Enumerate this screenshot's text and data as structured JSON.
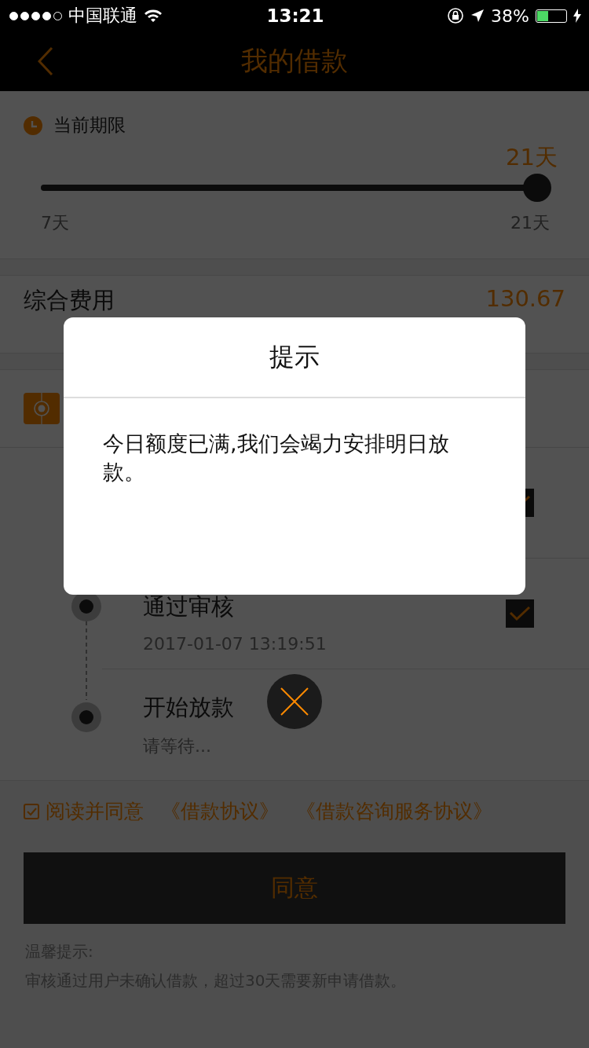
{
  "status_bar": {
    "signal_dots": [
      {
        "on": true
      },
      {
        "on": true
      },
      {
        "on": true
      },
      {
        "on": true
      },
      {
        "on": false
      }
    ],
    "carrier": "中国联通",
    "time": "13:21",
    "battery_text": "38%",
    "battery": {
      "level": 0.38
    }
  },
  "nav": {
    "title": "我的借款"
  },
  "term": {
    "label": "当前期限",
    "current": "21天",
    "level": 1,
    "min": "7天",
    "max": "21天"
  },
  "fee": {
    "label": "综合费用",
    "value": "130.67"
  },
  "steps": [
    {
      "checked": true
    },
    {
      "title": "通过审核",
      "time": "2017-01-07 13:19:51",
      "checked": true
    },
    {
      "title": "开始放款",
      "time": "请等待...",
      "checked": false
    }
  ],
  "agreement": {
    "checked": true,
    "label": "阅读并同意",
    "links": [
      "《借款协议》",
      "《借款咨询服务协议》"
    ]
  },
  "agree_button": "同意",
  "tips": {
    "title": "温馨提示:",
    "text": "审核通过用户未确认借款，超过30天需要新申请借款。"
  },
  "dialog": {
    "title": "提示",
    "message": "今日额度已满,我们会竭力安排明日放款。"
  }
}
